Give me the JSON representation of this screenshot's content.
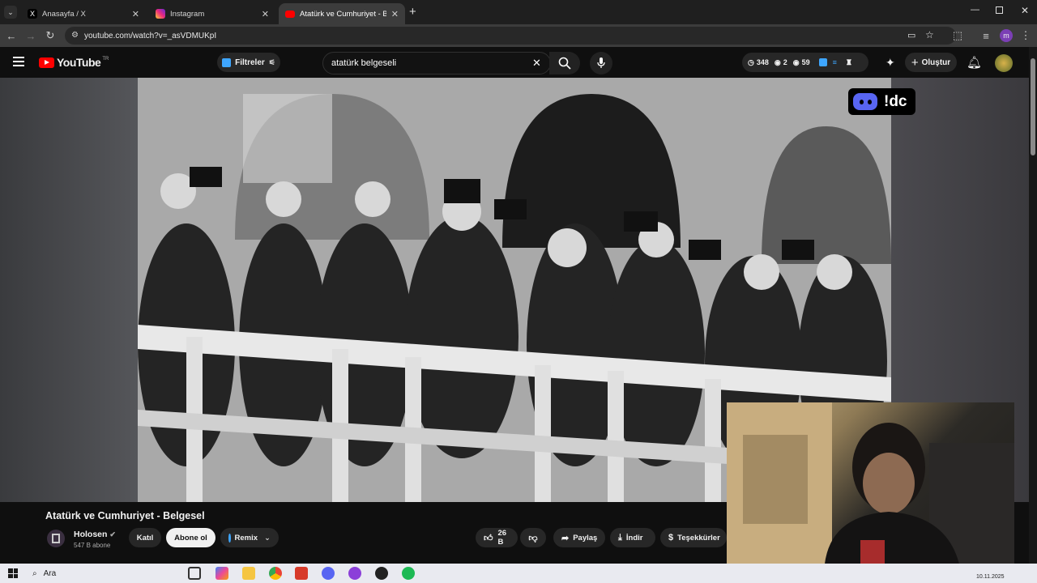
{
  "browser": {
    "tabs": [
      {
        "title": "Anasayfa / X",
        "icon": "x-logo-icon"
      },
      {
        "title": "Instagram",
        "icon": "instagram-icon"
      },
      {
        "title": "Atatürk ve Cumhuriyet - Belgesel",
        "icon": "youtube-icon"
      }
    ],
    "url": "youtube.com/watch?v=_asVDMUKpI"
  },
  "youtube": {
    "logo_text": "YouTube",
    "region": "TR",
    "filters_label": "Filtreler",
    "search_value": "atatürk belgeseli",
    "stats": {
      "watching": "348",
      "second": "2",
      "third": "59"
    },
    "create_label": "Oluştur"
  },
  "overlay": {
    "discord_text": "!dc"
  },
  "video": {
    "title": "Atatürk ve Cumhuriyet - Belgesel",
    "channel": "Holosen",
    "subscribers": "547 B abone",
    "join_label": "Katıl",
    "subscribe_label": "Abone ol",
    "remix_label": "Remix",
    "likes": "26 B",
    "share_label": "Paylaş",
    "download_label": "İndir",
    "thanks_label": "Teşekkürler"
  },
  "taskbar": {
    "search_label": "Ara",
    "date": "10.11.2025"
  },
  "colors": {
    "youtube_red": "#ff0000",
    "discord": "#5865f2",
    "accent_blue": "#3ea6ff"
  }
}
